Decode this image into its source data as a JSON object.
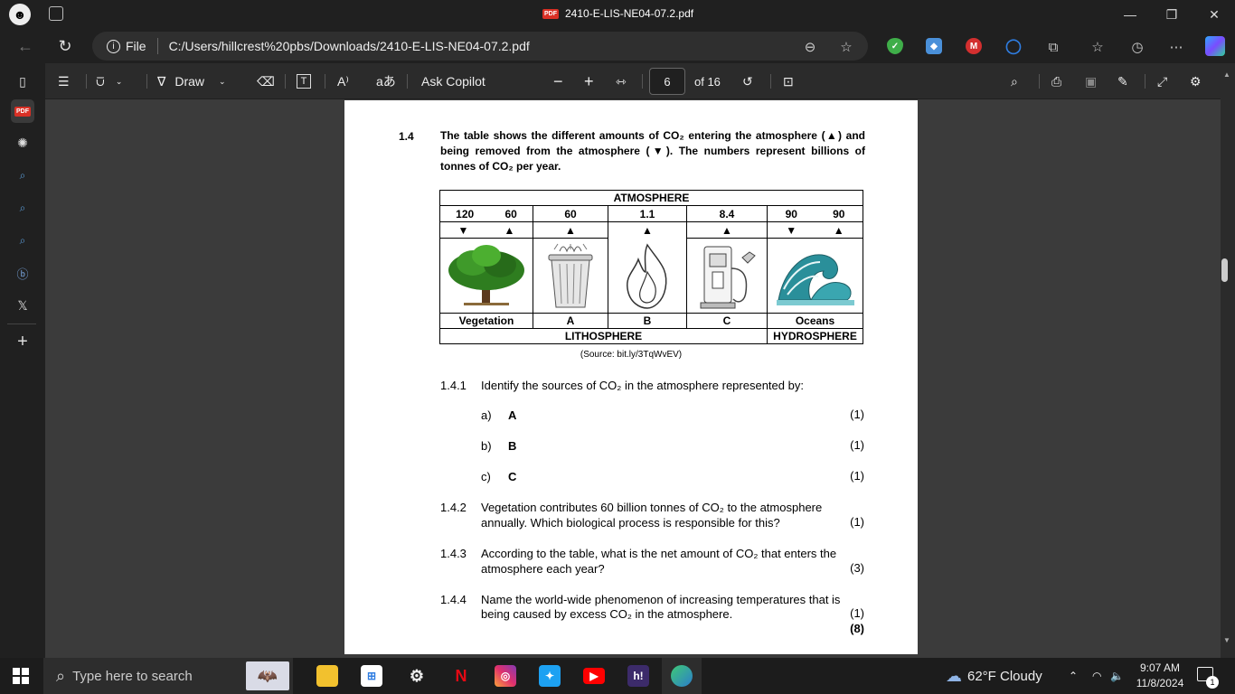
{
  "window": {
    "title": "2410-E-LIS-NE04-07.2.pdf",
    "pdf_badge": "PDF"
  },
  "address": {
    "file_label": "File",
    "url": "C:/Users/hillcrest%20pbs/Downloads/2410-E-LIS-NE04-07.2.pdf"
  },
  "toolbar": {
    "draw_label": "Draw",
    "ask_copilot": "Ask Copilot",
    "page_current": "6",
    "page_total": "of 16"
  },
  "document": {
    "q14_number": "1.4",
    "q14_text": "The table shows the different amounts of CO₂ entering the atmosphere (▲) and being removed from the atmosphere (▼). The numbers represent billions of tonnes of CO₂ per year.",
    "table": {
      "header": "ATMOSPHERE",
      "values": {
        "veg_out": "120",
        "veg_in": "60",
        "a": "60",
        "b": "1.1",
        "c": "8.4",
        "oc_out": "90",
        "oc_in": "90"
      },
      "labels": {
        "veg": "Vegetation",
        "a": "A",
        "b": "B",
        "c": "C",
        "oceans": "Oceans"
      },
      "footer_left": "LITHOSPHERE",
      "footer_right": "HYDROSPHERE"
    },
    "source": "(Source: bit.ly/3TqWvEV)",
    "q141_num": "1.4.1",
    "q141_text": "Identify the sources of CO₂ in the atmosphere represented by:",
    "qa_label": "a)",
    "qa_letter": "A",
    "qa_marks": "(1)",
    "qb_label": "b)",
    "qb_letter": "B",
    "qb_marks": "(1)",
    "qc_label": "c)",
    "qc_letter": "C",
    "qc_marks": "(1)",
    "q142_num": "1.4.2",
    "q142_line1": "Vegetation contributes 60 billion tonnes of CO₂ to the atmosphere",
    "q142_line2": "annually. Which biological process is responsible for this?",
    "q142_marks": "(1)",
    "q143_num": "1.4.3",
    "q143_line1": "According to the table, what is the net amount of CO₂ that enters the",
    "q143_line2": "atmosphere each year?",
    "q143_marks": "(3)",
    "q144_num": "1.4.4",
    "q144_line1": "Name the world-wide phenomenon of increasing temperatures that is",
    "q144_line2": "being caused by excess CO₂ in the atmosphere.",
    "q144_marks": "(1)",
    "total_marks": "(8)"
  },
  "taskbar": {
    "search_placeholder": "Type here to search",
    "weather": "62°F  Cloudy",
    "time": "9:07 AM",
    "date": "11/8/2024",
    "notif_count": "1"
  }
}
